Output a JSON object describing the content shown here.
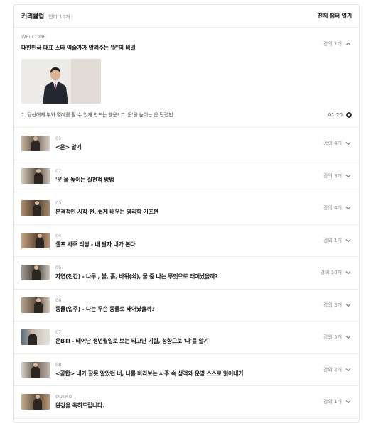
{
  "header": {
    "title": "커리큘럼",
    "count": "챕터 10개",
    "open_all": "전체 챕터 열기"
  },
  "welcome": {
    "tag": "WELCOME",
    "title": "대한민국 대표 스타 역술가가 알려주는 '운'의 비밀",
    "meta": "강의 1개",
    "lesson_title": "1. 당신에게 부와 명예를 쥘 수 있게 만드는 행운! 그 '운'을 높이는 운 단련법",
    "lesson_duration": "01:20"
  },
  "chapters": [
    {
      "num": "01",
      "title": "<운> 알기",
      "meta": "강의 4개"
    },
    {
      "num": "02",
      "title": "'운'을 높이는 실천적 방법",
      "meta": "강의 3개"
    },
    {
      "num": "03",
      "title": "본격적인 시작 전, 쉽게 배우는 명리학 기초편",
      "meta": "강의 4개"
    },
    {
      "num": "04",
      "title": "셀프 사주 리딩 - 내 팔자 내가 본다",
      "meta": "강의 1개"
    },
    {
      "num": "05",
      "title": "자연(천간) - 나무 , 불, 흙, 바위(쇠), 물 중 나는 무엇으로 태어났을까?",
      "meta": "강의 10개"
    },
    {
      "num": "06",
      "title": "동물(일주) - 나는 무슨 동물로 태어났을까?",
      "meta": "강의 5개"
    },
    {
      "num": "07",
      "title": "운BTI - 태어난 생년월일로 보는 타고난 기질, 성향으로 '나'를 알기",
      "meta": "강의 5개"
    },
    {
      "num": "08",
      "title": "<공합> 내가 잘못 알았던 너, 나를 바라보는 사주 속 성격와 운명 스스로 읽어내기",
      "meta": "강의 2개"
    },
    {
      "num": "OUTRO",
      "title": "완강을 축하드립니다.",
      "meta": "강의 1개"
    }
  ]
}
